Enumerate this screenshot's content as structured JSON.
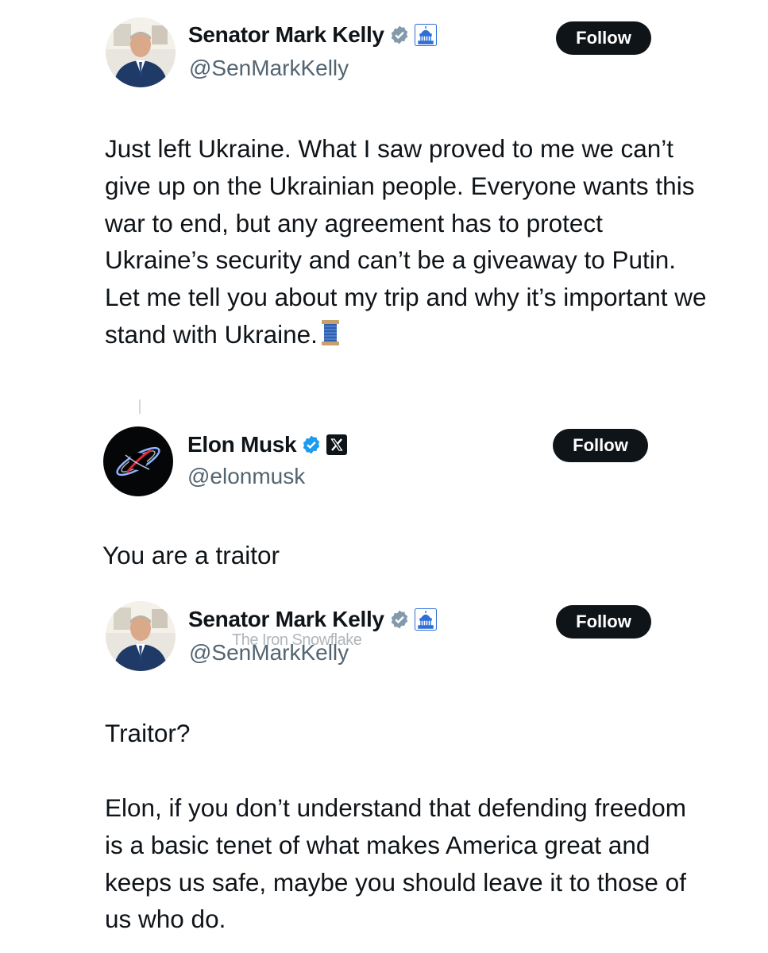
{
  "tweets": [
    {
      "author_name": "Senator Mark Kelly",
      "handle": "@SenMarkKelly",
      "follow_label": "Follow",
      "badge_icons": [
        "verified-badge-icon",
        "capitol-affiliation-icon"
      ],
      "text": "Just left Ukraine. What I saw proved to me we can’t give up on the Ukrainian people. Everyone wants this war to end, but any agreement has to protect Ukraine’s security and can’t be a giveaway to Putin. Let me tell you about my trip and why it’s important we stand with Ukraine.",
      "trailing_emoji": "spool-of-thread-emoji"
    },
    {
      "author_name": "Elon Musk",
      "handle": "@elonmusk",
      "follow_label": "Follow",
      "badge_icons": [
        "verified-badge-icon",
        "x-logo-affiliation-icon"
      ],
      "text": "You are a traitor"
    },
    {
      "author_name": "Senator Mark Kelly",
      "handle": "@SenMarkKelly",
      "follow_label": "Follow",
      "badge_icons": [
        "verified-badge-icon",
        "capitol-affiliation-icon"
      ],
      "text": "Traitor?",
      "text2": "Elon, if you don’t understand that defending freedom is a basic tenet of what makes America great and keeps us safe, maybe you should leave it to those of us who do."
    }
  ],
  "watermark": "The Iron Snowflake",
  "colors": {
    "text": "#0f1419",
    "secondary_text": "#536471",
    "follow_button_bg": "#0f1419",
    "follow_button_text": "#ffffff",
    "verified_badge": "#1d9bf0",
    "government_badge": "#829aab"
  }
}
